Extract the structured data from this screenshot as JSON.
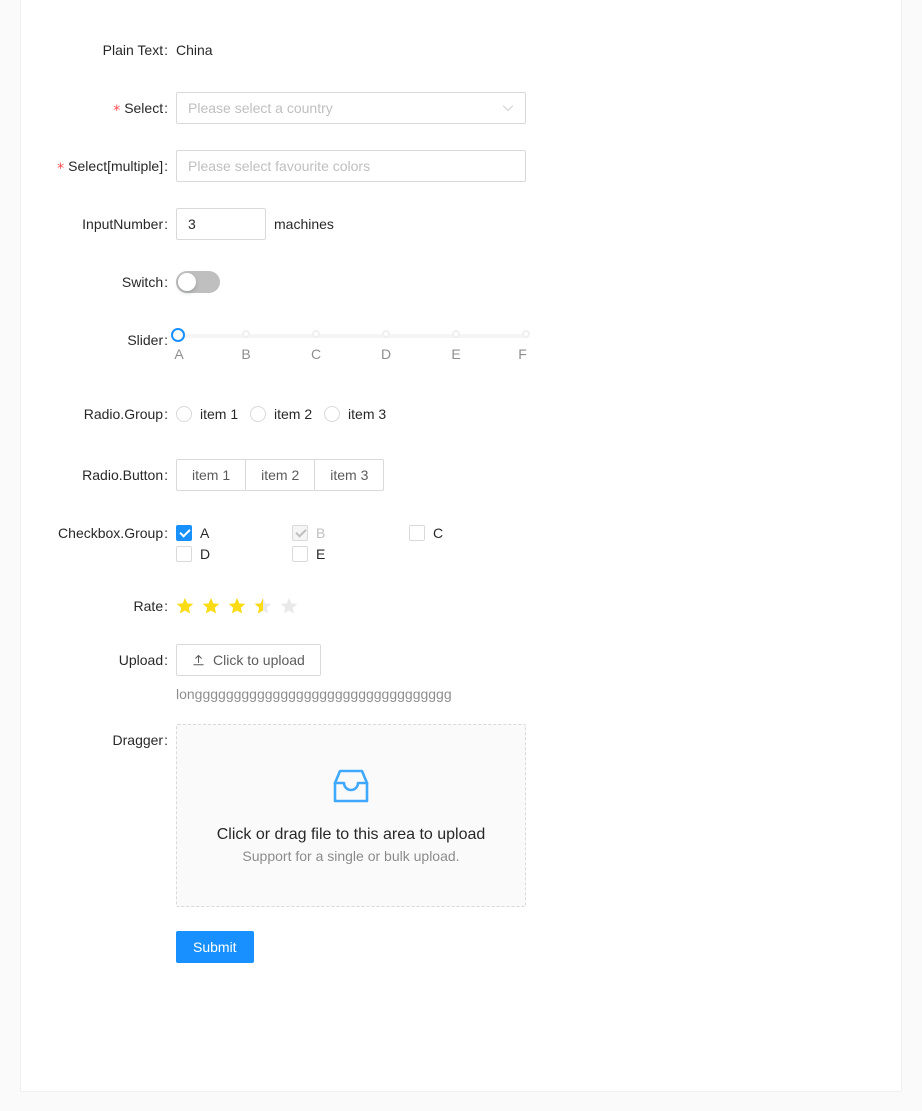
{
  "form": {
    "rows": [
      {
        "label": "Plain Text",
        "required": false,
        "value": "China"
      },
      {
        "label": "Select",
        "required": true,
        "placeholder": "Please select a country"
      },
      {
        "label": "Select[multiple]",
        "required": true,
        "placeholder": "Please select favourite colors"
      },
      {
        "label": "InputNumber",
        "required": false,
        "value": "3",
        "suffix": "machines"
      },
      {
        "label": "Switch",
        "required": false
      },
      {
        "label": "Slider",
        "required": false
      },
      {
        "label": "Radio.Group",
        "required": false
      },
      {
        "label": "Radio.Button",
        "required": false
      },
      {
        "label": "Checkbox.Group",
        "required": false
      },
      {
        "label": "Rate",
        "required": false
      },
      {
        "label": "Upload",
        "required": false
      },
      {
        "label": "Dragger",
        "required": false
      }
    ],
    "colon": ":"
  },
  "plain_text": {
    "label": "Plain Text",
    "value": "China"
  },
  "select": {
    "label": "Select",
    "placeholder": "Please select a country",
    "required_marker": "*",
    "arrow_icon": "chevron-down-icon"
  },
  "select_multiple": {
    "label": "Select[multiple]",
    "placeholder": "Please select favourite colors",
    "required_marker": "*"
  },
  "input_number": {
    "label": "InputNumber",
    "value": "3",
    "suffix": "machines"
  },
  "switch": {
    "label": "Switch",
    "checked": false
  },
  "slider": {
    "label": "Slider",
    "value_index": 0,
    "marks": [
      "A",
      "B",
      "C",
      "D",
      "E",
      "F"
    ]
  },
  "radio_group": {
    "label": "Radio.Group",
    "options": [
      "item 1",
      "item 2",
      "item 3"
    ],
    "selected": null
  },
  "radio_button": {
    "label": "Radio.Button",
    "options": [
      "item 1",
      "item 2",
      "item 3"
    ],
    "selected": null
  },
  "checkbox_group": {
    "label": "Checkbox.Group",
    "options": [
      {
        "label": "A",
        "checked": true,
        "disabled": false
      },
      {
        "label": "B",
        "checked": true,
        "disabled": true
      },
      {
        "label": "C",
        "checked": false,
        "disabled": false
      },
      {
        "label": "D",
        "checked": false,
        "disabled": false
      },
      {
        "label": "E",
        "checked": false,
        "disabled": false
      }
    ]
  },
  "rate": {
    "label": "Rate",
    "value": "3.5",
    "count": 5,
    "star_color": "#fadb14",
    "empty_color": "#e9e9e9"
  },
  "upload": {
    "label": "Upload",
    "button_label": "Click to upload",
    "icon": "upload-icon",
    "file_name": "longgggggggggggggggggggggggggggggggg"
  },
  "dragger": {
    "label": "Dragger",
    "icon": "inbox-icon",
    "title": "Click or drag file to this area to upload",
    "hint": "Support for a single or bulk upload."
  },
  "submit": {
    "label": "Submit"
  },
  "colors": {
    "primary": "#1890ff",
    "required": "#ff4d4f",
    "star": "#fadb14",
    "border": "#d9d9d9",
    "panel": "#ffffff",
    "background": "#fafafa"
  }
}
